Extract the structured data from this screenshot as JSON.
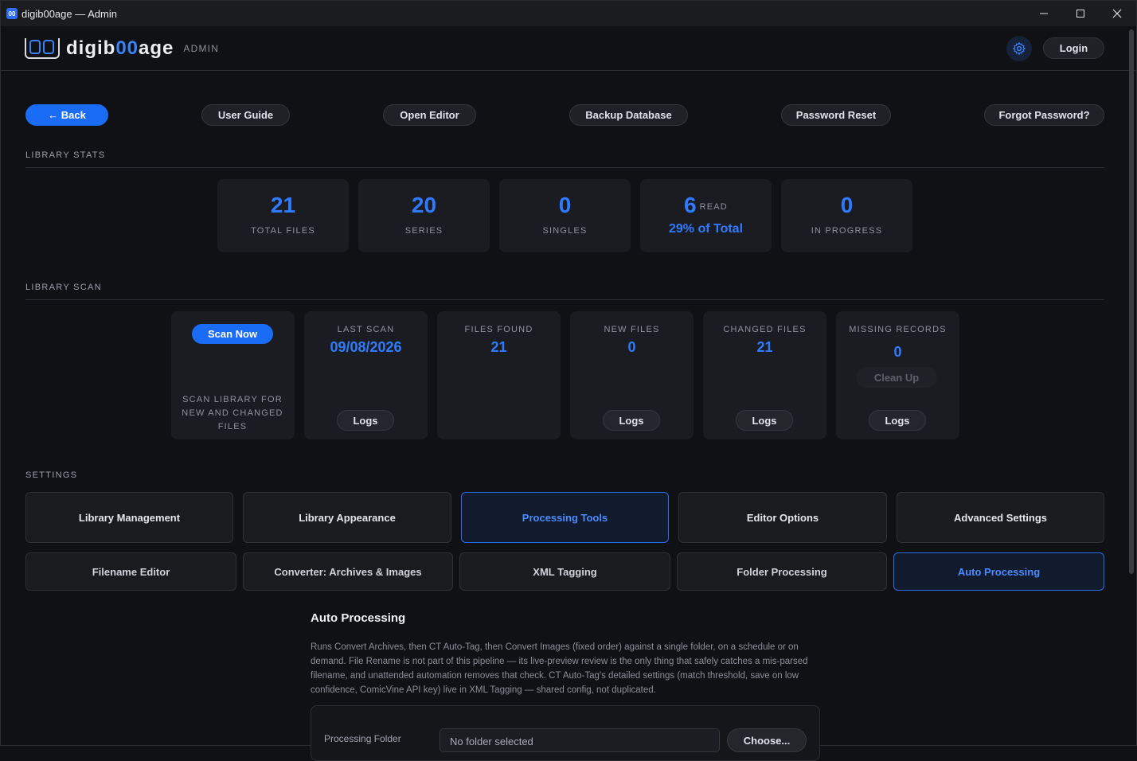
{
  "window": {
    "title": "digib00age — Admin",
    "app_icon_text": "00"
  },
  "header": {
    "logo_prefix": "digib",
    "logo_oo": "00",
    "logo_suffix": "age",
    "admin_label": "ADMIN",
    "login_label": "Login"
  },
  "toolbar": {
    "back": "← Back",
    "user_guide": "User Guide",
    "open_editor": "Open Editor",
    "backup_database": "Backup Database",
    "password_reset": "Password Reset",
    "forgot_password": "Forgot Password?"
  },
  "library_stats": {
    "label": "LIBRARY STATS",
    "total_files": {
      "value": "21",
      "label": "TOTAL FILES"
    },
    "series": {
      "value": "20",
      "label": "SERIES"
    },
    "singles": {
      "value": "0",
      "label": "SINGLES"
    },
    "read": {
      "value": "6",
      "label": "READ",
      "pct": "29% of Total"
    },
    "in_progress": {
      "value": "0",
      "label": "IN PROGRESS"
    }
  },
  "library_scan": {
    "label": "LIBRARY SCAN",
    "scan_now": "Scan Now",
    "scan_desc": "SCAN LIBRARY FOR NEW AND CHANGED FILES",
    "last_scan": {
      "label": "LAST SCAN",
      "value": "09/08/2026",
      "button": "Logs"
    },
    "files_found": {
      "label": "FILES FOUND",
      "value": "21"
    },
    "new_files": {
      "label": "NEW FILES",
      "value": "0",
      "button": "Logs"
    },
    "changed_files": {
      "label": "CHANGED FILES",
      "value": "21",
      "button": "Logs"
    },
    "missing_records": {
      "label": "MISSING RECORDS",
      "value": "0",
      "cleanup": "Clean Up",
      "button": "Logs"
    }
  },
  "settings": {
    "label": "SETTINGS",
    "tabs": [
      {
        "label": "Library Management"
      },
      {
        "label": "Library Appearance"
      },
      {
        "label": "Processing Tools"
      },
      {
        "label": "Editor Options"
      },
      {
        "label": "Advanced Settings"
      }
    ],
    "subtabs": [
      {
        "label": "Filename Editor"
      },
      {
        "label": "Converter: Archives & Images"
      },
      {
        "label": "XML Tagging"
      },
      {
        "label": "Folder Processing"
      },
      {
        "label": "Auto Processing"
      }
    ]
  },
  "auto_processing": {
    "title": "Auto Processing",
    "description": "Runs Convert Archives, then CT Auto-Tag, then Convert Images (fixed order) against a single folder, on a schedule or on demand. File Rename is not part of this pipeline — its live-preview review is the only thing that safely catches a mis-parsed filename, and unattended automation removes that check. CT Auto-Tag's detailed settings (match threshold, save on low confidence, ComicVine API key) live in XML Tagging — shared config, not duplicated.",
    "folder_label": "Processing Folder",
    "folder_value": "No folder selected",
    "choose_label": "Choose..."
  },
  "colors": {
    "accent": "#2f7bff",
    "primary_button": "#1a6cf5",
    "background": "#101114",
    "card": "#1b1c21"
  }
}
